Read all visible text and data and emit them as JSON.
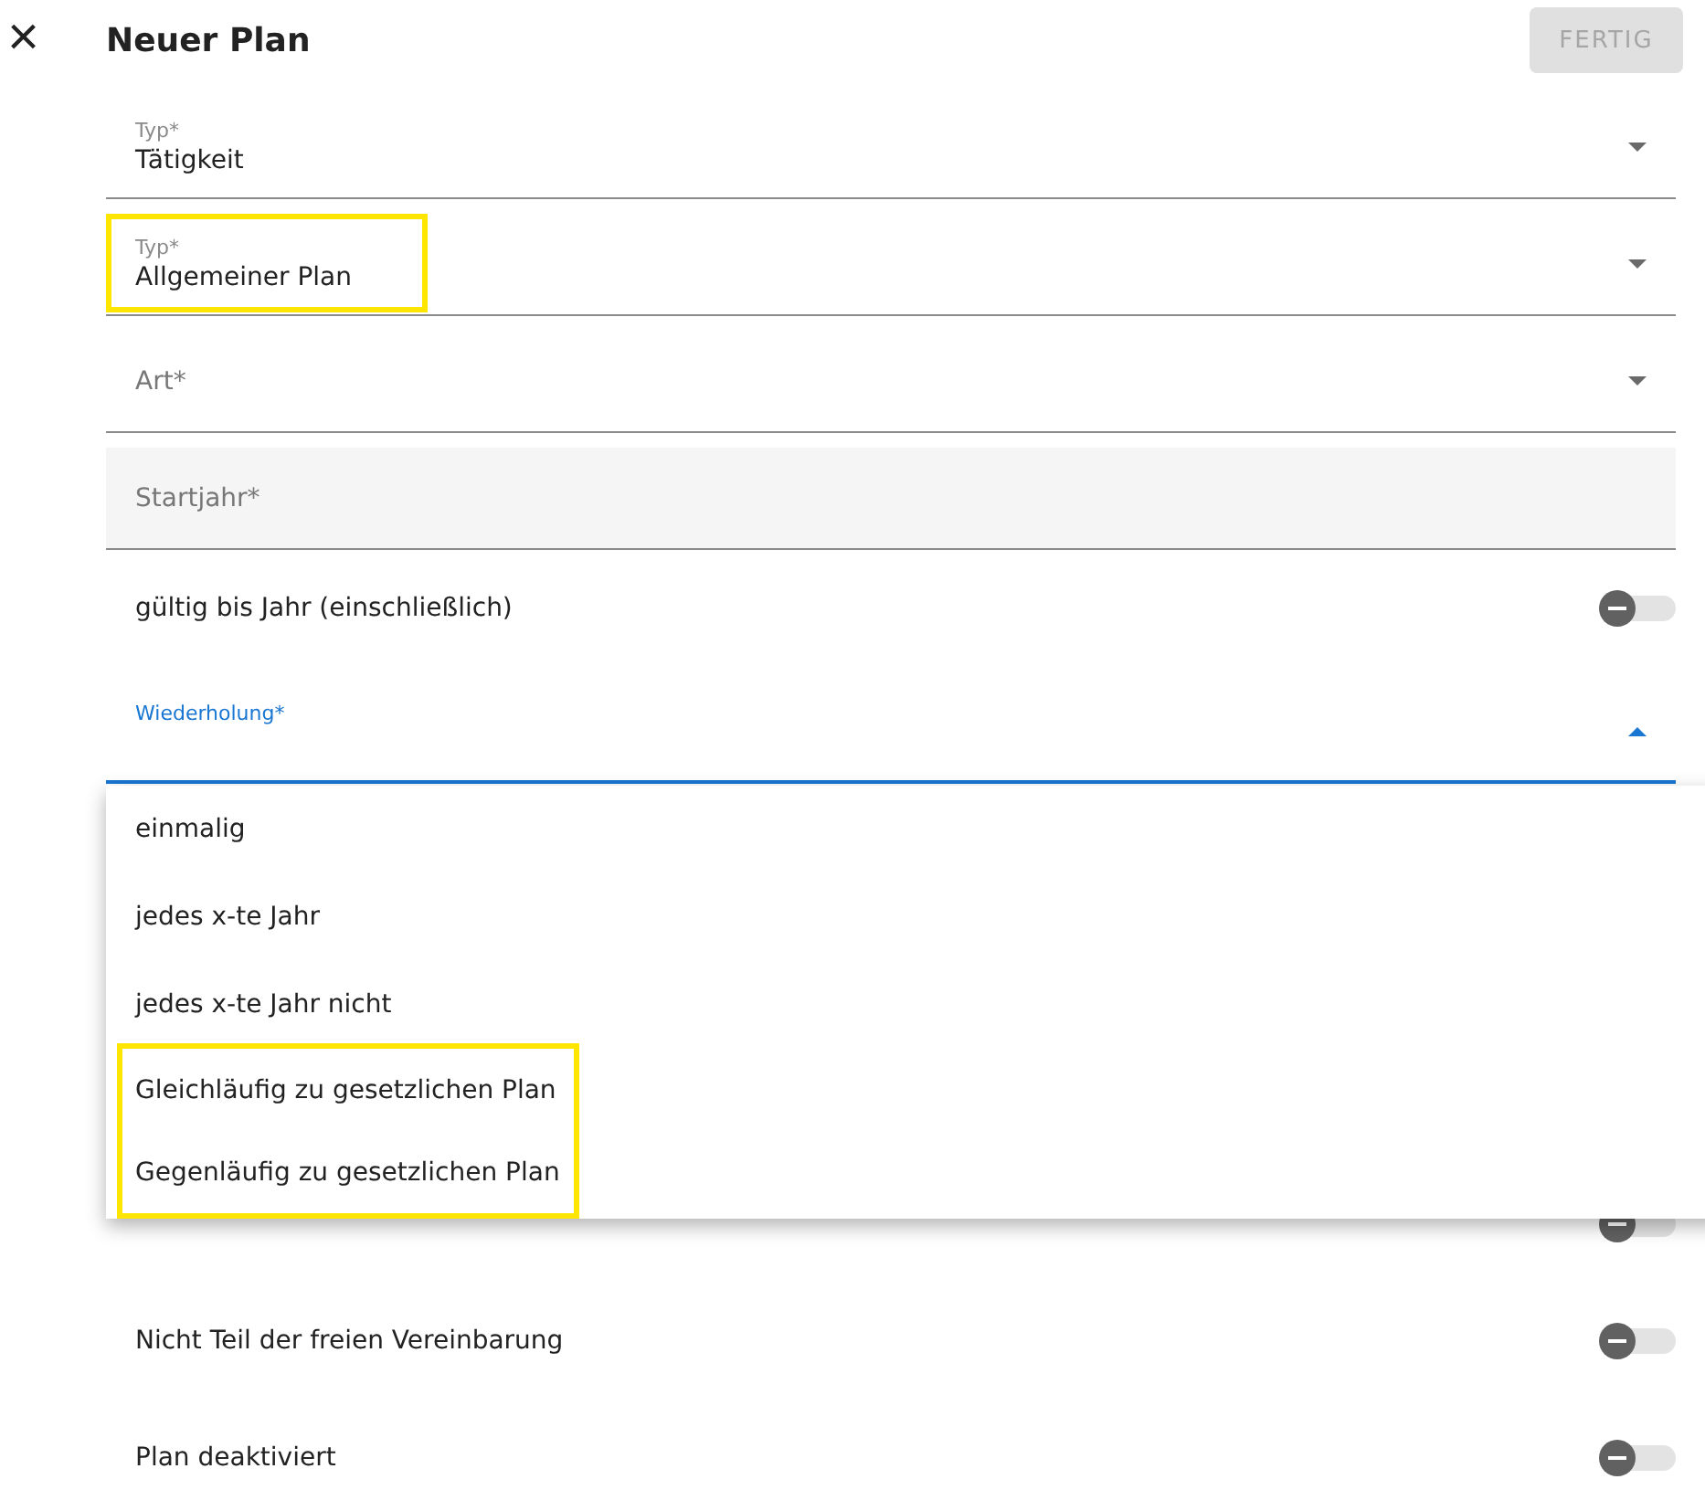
{
  "header": {
    "close": "×",
    "title": "Neuer Plan",
    "done_button": {
      "label": "FERTIG",
      "disabled": true
    }
  },
  "fields": [
    {
      "kind": "select",
      "label": "Typ*",
      "value": "Tätigkeit",
      "highlighted": false
    },
    {
      "kind": "select",
      "label": "Typ*",
      "value": "Allgemeiner Plan",
      "highlighted": true
    },
    {
      "kind": "select",
      "placeholder": "Art*",
      "highlighted": false
    },
    {
      "kind": "text",
      "placeholder": "Startjahr*",
      "highlighted": false
    },
    {
      "kind": "toggle",
      "label": "gültig bis Jahr (einschließlich)",
      "on": false
    },
    {
      "kind": "select",
      "label": "Wiederholung*",
      "focused": true,
      "expanded": true,
      "highlighted": false
    }
  ],
  "menu": {
    "options": [
      {
        "label": "einmalig",
        "highlighted": false
      },
      {
        "label": "jedes x-te Jahr",
        "highlighted": false
      },
      {
        "label": "jedes x-te Jahr nicht",
        "highlighted": false
      },
      {
        "label": "Gleichläufig zu gesetzlichen Plan",
        "highlighted": true
      },
      {
        "label": "Gegenläufig zu gesetzlichen Plan",
        "highlighted": true
      }
    ]
  },
  "toggles": [
    {
      "on": false
    },
    {
      "label": "Nicht Teil der freien Vereinbarung",
      "on": false
    },
    {
      "label": "Plan deaktiviert",
      "on": false
    }
  ]
}
